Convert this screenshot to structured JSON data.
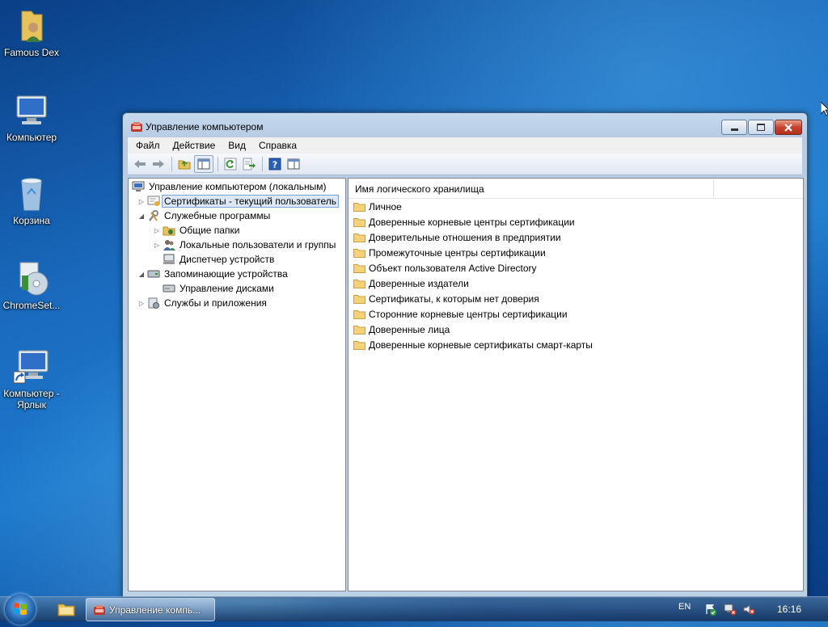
{
  "desktop": {
    "icons": [
      {
        "label": "Famous Dex",
        "icon": "user-folder-icon"
      },
      {
        "label": "Компьютер",
        "icon": "computer-icon"
      },
      {
        "label": "Корзина",
        "icon": "recycle-bin-icon"
      },
      {
        "label": "ChromeSet...",
        "icon": "installer-icon"
      },
      {
        "label": "Компьютер - Ярлык",
        "icon": "computer-shortcut-icon"
      }
    ]
  },
  "window": {
    "title": "Управление компьютером",
    "menu": [
      "Файл",
      "Действие",
      "Вид",
      "Справка"
    ],
    "tree": {
      "root": "Управление компьютером (локальным)",
      "items": [
        {
          "label": "Сертификаты - текущий пользователь",
          "selected": true
        },
        {
          "label": "Служебные программы"
        },
        {
          "label": "Общие папки"
        },
        {
          "label": "Локальные пользователи и группы"
        },
        {
          "label": "Диспетчер устройств"
        },
        {
          "label": "Запоминающие устройства"
        },
        {
          "label": "Управление дисками"
        },
        {
          "label": "Службы и приложения"
        }
      ]
    },
    "list": {
      "column_header": "Имя логического хранилища",
      "items": [
        "Личное",
        "Доверенные корневые центры сертификации",
        "Доверительные отношения в предприятии",
        "Промежуточные центры сертификации",
        "Объект пользователя Active Directory",
        "Доверенные издатели",
        "Сертификаты, к которым нет доверия",
        "Сторонние корневые центры сертификации",
        "Доверенные лица",
        "Доверенные корневые сертификаты смарт-карты"
      ]
    }
  },
  "taskbar": {
    "task_label": "Управление компь...",
    "language": "EN",
    "clock": "16:16"
  },
  "colors": {
    "folder": "#f3d27a",
    "selection": "#dce8f6"
  }
}
